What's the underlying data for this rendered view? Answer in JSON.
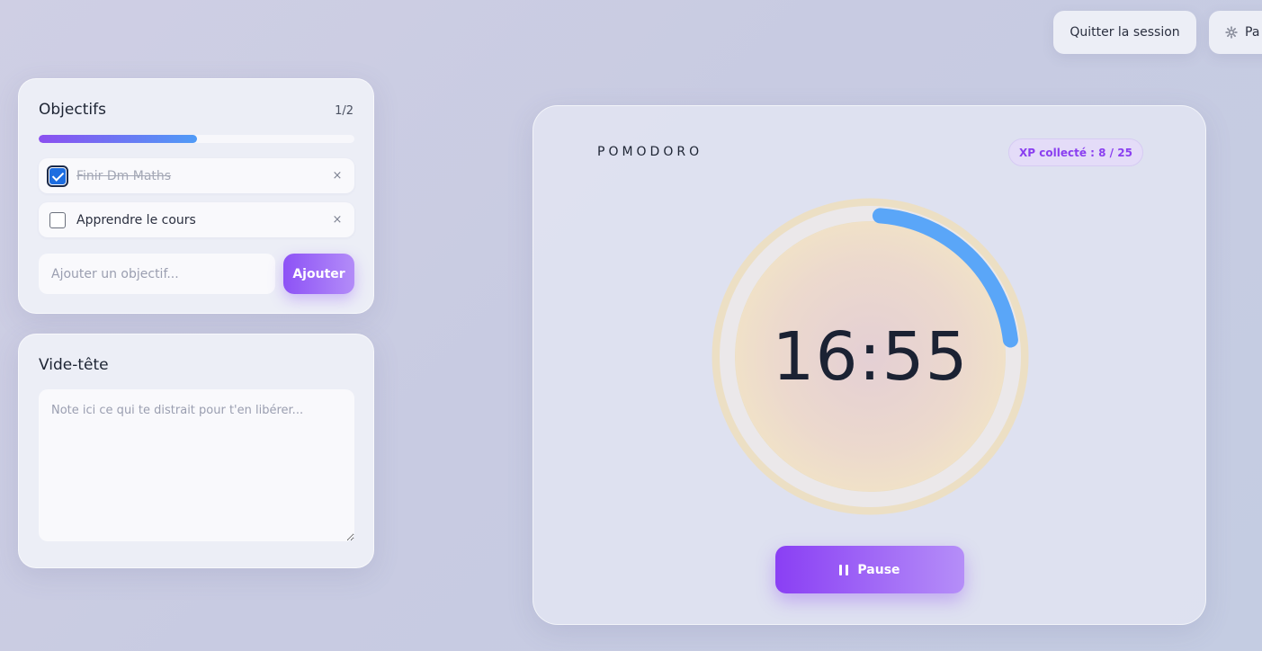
{
  "header": {
    "quit_label": "Quitter la session",
    "settings_label": "Pa"
  },
  "goals": {
    "title": "Objectifs",
    "count": "1/2",
    "progress": 0.5,
    "items": [
      {
        "label": "Finir Dm Maths",
        "done": true
      },
      {
        "label": "Apprendre le cours",
        "done": false
      }
    ],
    "remove_symbol": "×",
    "input_placeholder": "Ajouter un objectif...",
    "add_label": "Ajouter"
  },
  "braindump": {
    "title": "Vide-tête",
    "placeholder": "Note ici ce qui te distrait pour t'en libérer..."
  },
  "pomodoro": {
    "label": "POMODORO",
    "xp": "XP collecté : 8 / 25",
    "time": "16:55",
    "progress": 0.22,
    "pause_label": "Pause"
  },
  "colors": {
    "accent_purple": "#8a3ff4",
    "ring_blue": "#5aa6f8",
    "ring_outer": "#ecdfc4"
  }
}
